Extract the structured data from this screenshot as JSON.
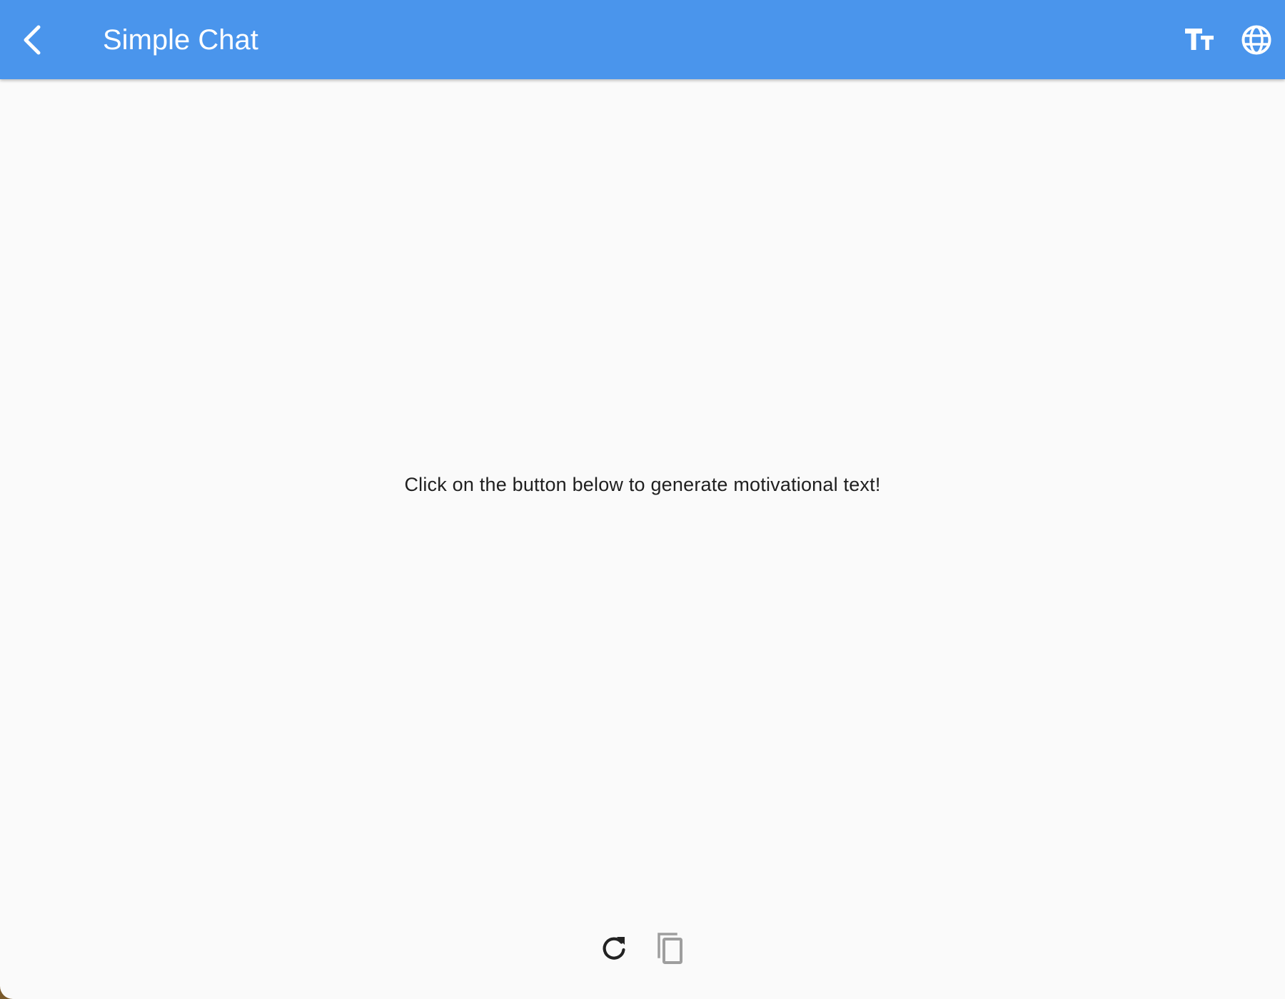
{
  "appbar": {
    "title": "Simple Chat",
    "back_icon": "chevron-left-icon",
    "actions": [
      {
        "name": "font-size",
        "icon": "text-size-icon"
      },
      {
        "name": "language",
        "icon": "globe-icon"
      }
    ],
    "background_color": "#4a95ec"
  },
  "main": {
    "message": "Click on the button below to generate motivational text!"
  },
  "bottom_actions": [
    {
      "name": "refresh",
      "icon": "refresh-icon",
      "color": "#222222"
    },
    {
      "name": "copy",
      "icon": "copy-icon",
      "color": "#9e9e9e"
    }
  ]
}
